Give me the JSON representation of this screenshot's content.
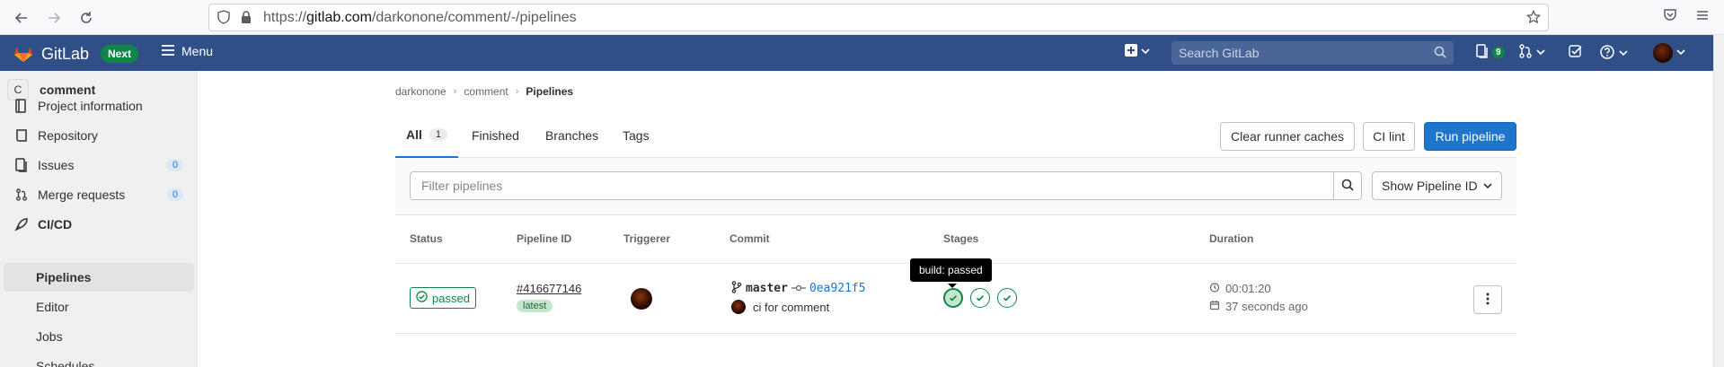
{
  "browser": {
    "url_prefix": "https://",
    "url_host": "gitlab.com",
    "url_path": "/darkonone/comment/-/pipelines"
  },
  "topnav": {
    "brand": "GitLab",
    "next_badge": "Next",
    "menu_label": "Menu",
    "search_placeholder": "Search GitLab",
    "issues_count": "9"
  },
  "sidebar": {
    "project_initial": "C",
    "project_name": "comment",
    "items": [
      {
        "label": "Project information",
        "icon": "info-icon"
      },
      {
        "label": "Repository",
        "icon": "repository-icon"
      },
      {
        "label": "Issues",
        "icon": "issues-icon",
        "count": "0"
      },
      {
        "label": "Merge requests",
        "icon": "merge-request-icon",
        "count": "0"
      },
      {
        "label": "CI/CD",
        "icon": "rocket-icon"
      }
    ],
    "sub_items": [
      "Pipelines",
      "Editor",
      "Jobs",
      "Schedules"
    ]
  },
  "breadcrumb": {
    "owner": "darkonone",
    "project": "comment",
    "current": "Pipelines"
  },
  "tabs": [
    {
      "label": "All",
      "count": "1"
    },
    {
      "label": "Finished"
    },
    {
      "label": "Branches"
    },
    {
      "label": "Tags"
    }
  ],
  "actions": {
    "clear_caches": "Clear runner caches",
    "ci_lint": "CI lint",
    "run_pipeline": "Run pipeline"
  },
  "filter": {
    "placeholder": "Filter pipelines",
    "select_label": "Show Pipeline ID"
  },
  "table": {
    "headers": [
      "Status",
      "Pipeline ID",
      "Triggerer",
      "Commit",
      "Stages",
      "Duration"
    ],
    "rows": [
      {
        "status": "passed",
        "pipeline_id": "#416677146",
        "badge": "latest",
        "branch": "master",
        "sha": "0ea921f5",
        "commit_title": "ci for comment",
        "stages": [
          "passed",
          "passed",
          "passed"
        ],
        "duration": "00:01:20",
        "finished": "37 seconds ago"
      }
    ]
  },
  "tooltip": "build: passed",
  "colors": {
    "nav_bg": "#2f4f86",
    "success": "#108548",
    "primary": "#1f75cb"
  }
}
